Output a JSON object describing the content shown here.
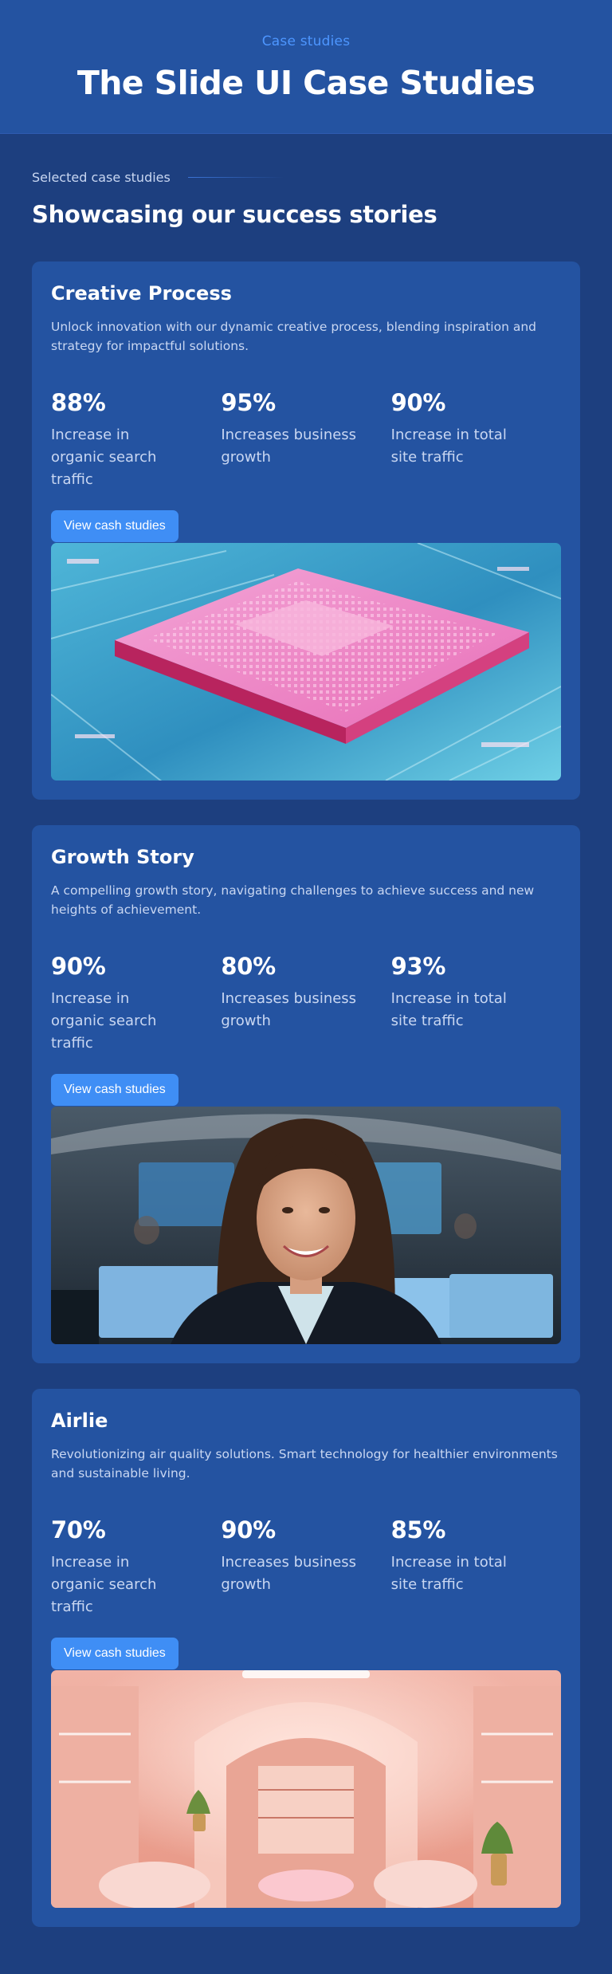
{
  "hero": {
    "eyebrow": "Case studies",
    "title": "The Slide UI Case Studies"
  },
  "section": {
    "label": "Selected case studies",
    "title": "Showcasing our success stories"
  },
  "cards": [
    {
      "title": "Creative Process",
      "description": "Unlock innovation with our dynamic creative process, blending inspiration and strategy for impactful solutions.",
      "stats": [
        {
          "value": "88%",
          "label": "Increase in organic search traffic"
        },
        {
          "value": "95%",
          "label": "Increases business growth"
        },
        {
          "value": "90%",
          "label": "Increase in total site traffic"
        }
      ],
      "cta": "View cash studies",
      "image": "circuit-chip-illustration"
    },
    {
      "title": "Growth Story",
      "description": "A compelling growth story, navigating challenges to achieve success and new heights of achievement.",
      "stats": [
        {
          "value": "90%",
          "label": "Increase in organic search traffic"
        },
        {
          "value": "80%",
          "label": "Increases business growth"
        },
        {
          "value": "93%",
          "label": "Increase in total site traffic"
        }
      ],
      "cta": "View cash studies",
      "image": "smiling-businesswoman-office-photo"
    },
    {
      "title": "Airlie",
      "description": "Revolutionizing air quality solutions. Smart technology for healthier environments and sustainable living.",
      "stats": [
        {
          "value": "70%",
          "label": "Increase in organic search traffic"
        },
        {
          "value": "90%",
          "label": "Increases business growth"
        },
        {
          "value": "85%",
          "label": "Increase in total site traffic"
        }
      ],
      "cta": "View cash studies",
      "image": "pink-boutique-interior-photo"
    }
  ],
  "colors": {
    "background": "#1d3f7f",
    "surface": "#2453a1",
    "accent": "#3f8ef5",
    "eyebrow": "#4d96ff",
    "muted_text": "#c9d7f2"
  }
}
